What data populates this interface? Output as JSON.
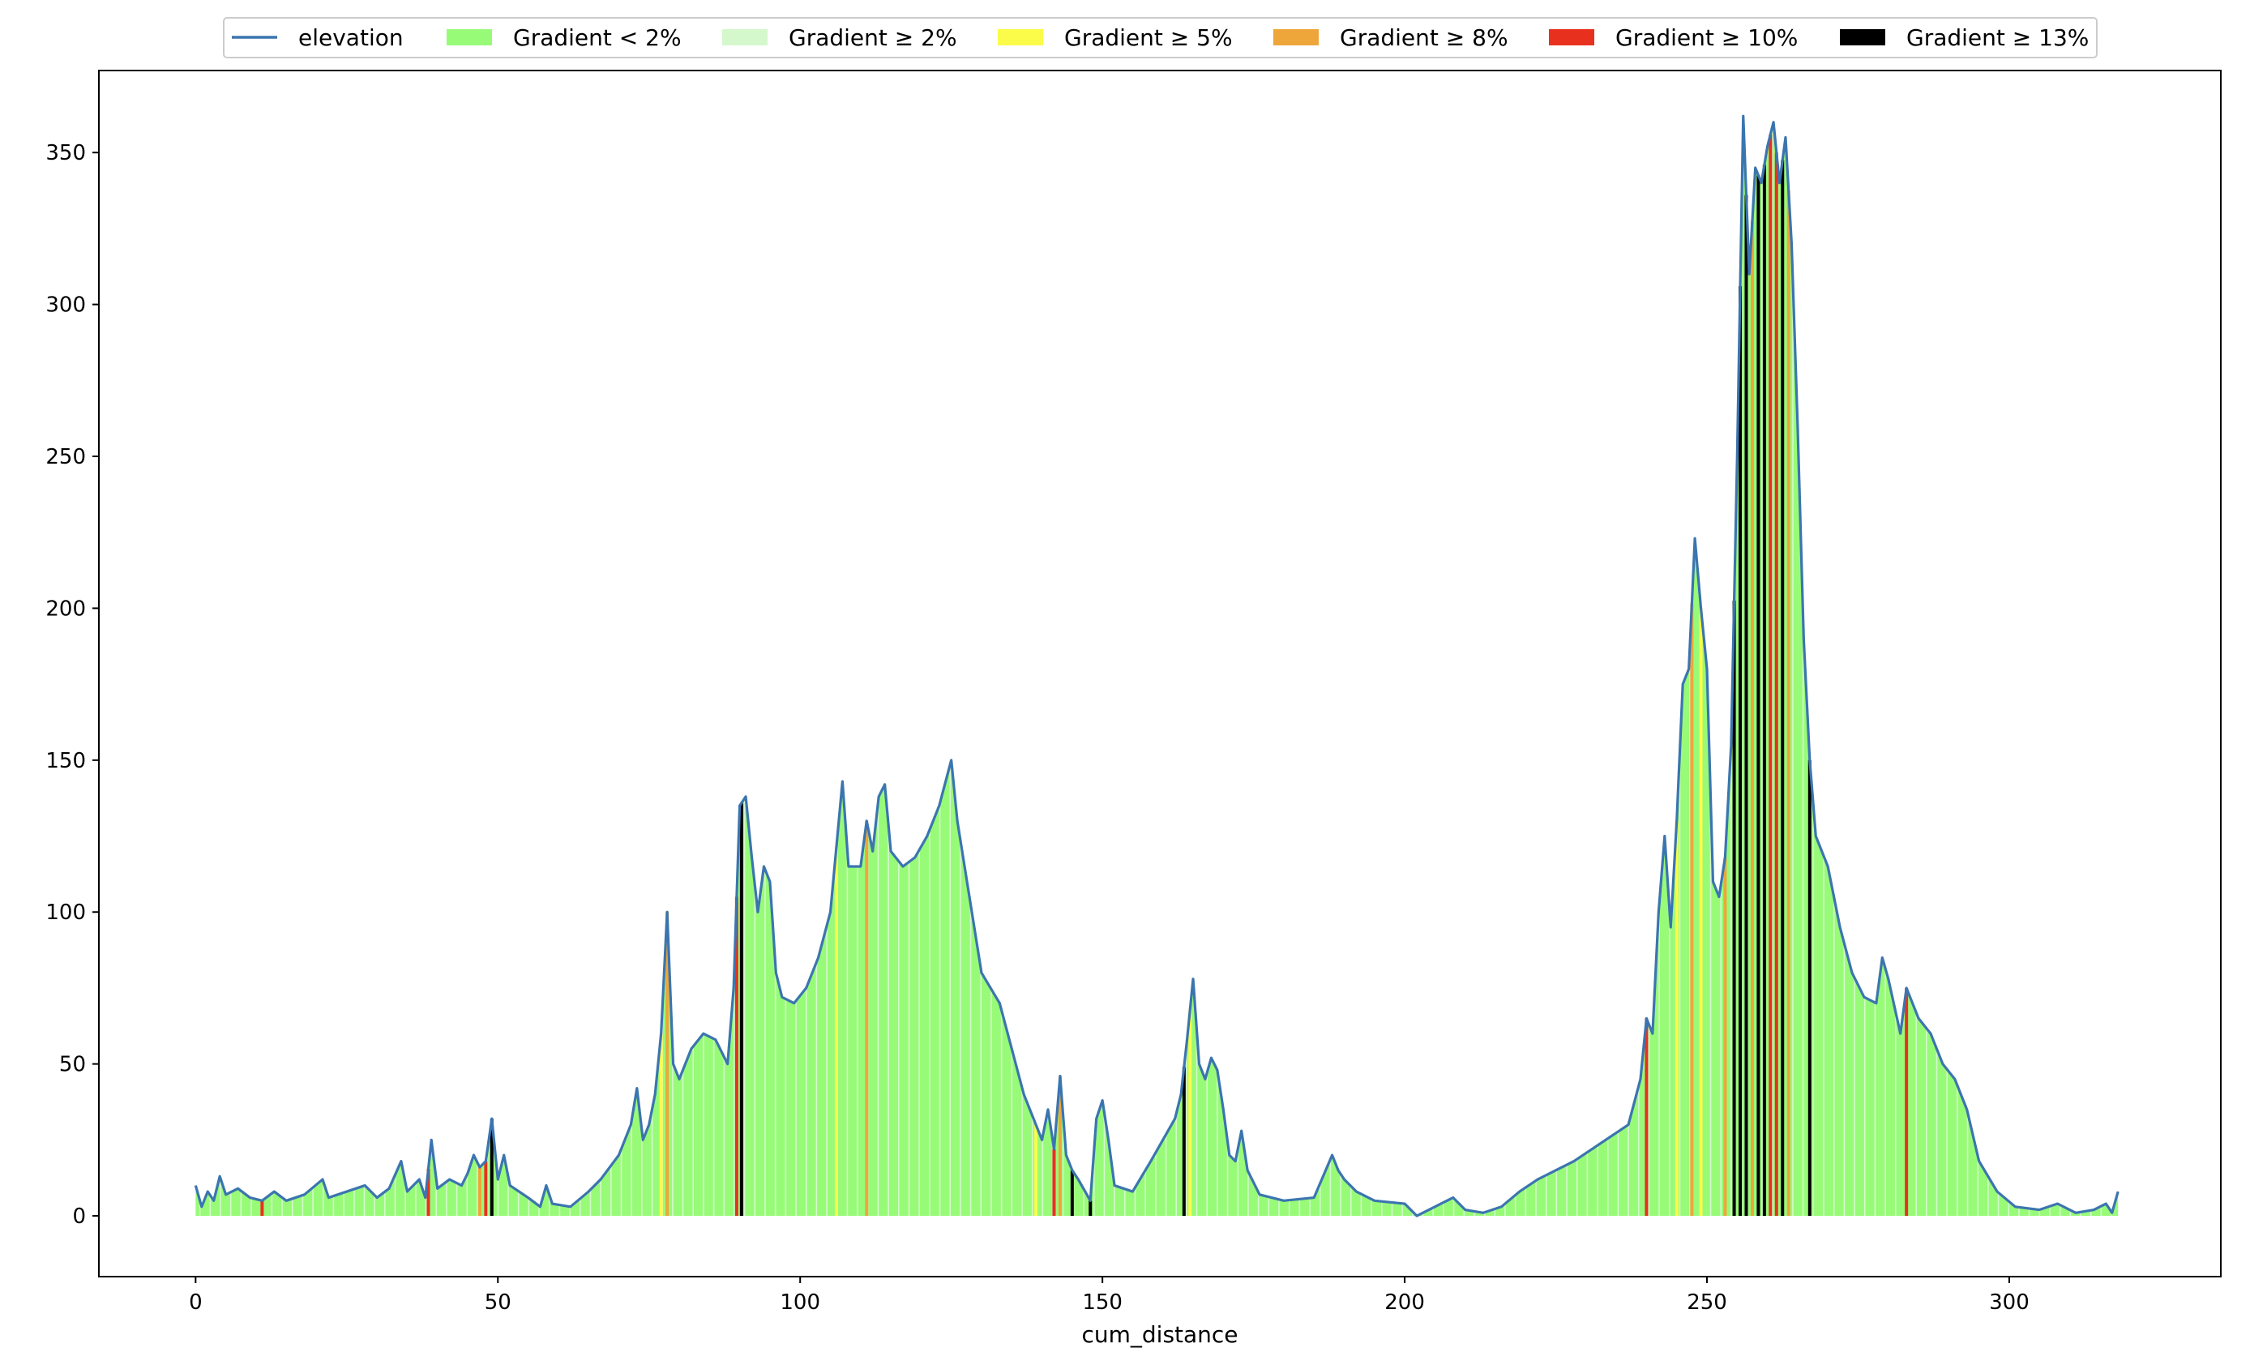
{
  "chart_data": {
    "type": "area",
    "xlabel": "cum_distance",
    "ylabel": "",
    "xlim": [
      -16,
      335
    ],
    "ylim": [
      -20,
      377
    ],
    "xticks": [
      0,
      50,
      100,
      150,
      200,
      250,
      300
    ],
    "yticks": [
      0,
      50,
      100,
      150,
      200,
      250,
      300,
      350
    ],
    "grid": false,
    "legend": {
      "placement": "top-center",
      "entries": [
        {
          "label": "elevation",
          "kind": "line",
          "color": "#3b75af"
        },
        {
          "label": "Gradient < 2%",
          "kind": "patch",
          "color": "#98fb78"
        },
        {
          "label": "Gradient ≥ 2%",
          "kind": "patch",
          "color": "#d4f8cc"
        },
        {
          "label": "Gradient ≥ 5%",
          "kind": "patch",
          "color": "#fbfb4a"
        },
        {
          "label": "Gradient ≥ 8%",
          "kind": "patch",
          "color": "#eea63a"
        },
        {
          "label": "Gradient ≥ 10%",
          "kind": "patch",
          "color": "#e8301f"
        },
        {
          "label": "Gradient ≥ 13%",
          "kind": "patch",
          "color": "#000000"
        }
      ]
    },
    "series": [
      {
        "name": "elevation",
        "points": [
          [
            0,
            10
          ],
          [
            1,
            3
          ],
          [
            2,
            8
          ],
          [
            3,
            5
          ],
          [
            4,
            13
          ],
          [
            5,
            7
          ],
          [
            7,
            9
          ],
          [
            9,
            6
          ],
          [
            11,
            5
          ],
          [
            13,
            8
          ],
          [
            15,
            5
          ],
          [
            18,
            7
          ],
          [
            21,
            12
          ],
          [
            22,
            6
          ],
          [
            25,
            8
          ],
          [
            28,
            10
          ],
          [
            30,
            6
          ],
          [
            32,
            9
          ],
          [
            34,
            18
          ],
          [
            35,
            8
          ],
          [
            37,
            12
          ],
          [
            38,
            6
          ],
          [
            39,
            25
          ],
          [
            40,
            9
          ],
          [
            42,
            12
          ],
          [
            44,
            10
          ],
          [
            45,
            14
          ],
          [
            46,
            20
          ],
          [
            47,
            16
          ],
          [
            48,
            18
          ],
          [
            49,
            32
          ],
          [
            50,
            12
          ],
          [
            51,
            20
          ],
          [
            52,
            10
          ],
          [
            55,
            6
          ],
          [
            57,
            3
          ],
          [
            58,
            10
          ],
          [
            59,
            4
          ],
          [
            62,
            3
          ],
          [
            65,
            8
          ],
          [
            67,
            12
          ],
          [
            70,
            20
          ],
          [
            72,
            30
          ],
          [
            73,
            42
          ],
          [
            74,
            25
          ],
          [
            75,
            30
          ],
          [
            76,
            40
          ],
          [
            77,
            60
          ],
          [
            78,
            100
          ],
          [
            79,
            50
          ],
          [
            80,
            45
          ],
          [
            82,
            55
          ],
          [
            84,
            60
          ],
          [
            86,
            58
          ],
          [
            88,
            50
          ],
          [
            89,
            75
          ],
          [
            90,
            135
          ],
          [
            91,
            138
          ],
          [
            92,
            118
          ],
          [
            93,
            100
          ],
          [
            94,
            115
          ],
          [
            95,
            110
          ],
          [
            96,
            80
          ],
          [
            97,
            72
          ],
          [
            99,
            70
          ],
          [
            101,
            75
          ],
          [
            103,
            85
          ],
          [
            105,
            100
          ],
          [
            107,
            143
          ],
          [
            108,
            115
          ],
          [
            110,
            115
          ],
          [
            111,
            130
          ],
          [
            112,
            120
          ],
          [
            113,
            138
          ],
          [
            114,
            142
          ],
          [
            115,
            120
          ],
          [
            117,
            115
          ],
          [
            119,
            118
          ],
          [
            121,
            125
          ],
          [
            123,
            135
          ],
          [
            125,
            150
          ],
          [
            126,
            130
          ],
          [
            128,
            105
          ],
          [
            130,
            80
          ],
          [
            133,
            70
          ],
          [
            135,
            55
          ],
          [
            137,
            40
          ],
          [
            139,
            30
          ],
          [
            140,
            25
          ],
          [
            141,
            35
          ],
          [
            142,
            22
          ],
          [
            143,
            46
          ],
          [
            144,
            20
          ],
          [
            145,
            15
          ],
          [
            146,
            12
          ],
          [
            148,
            5
          ],
          [
            149,
            32
          ],
          [
            150,
            38
          ],
          [
            151,
            25
          ],
          [
            152,
            10
          ],
          [
            155,
            8
          ],
          [
            158,
            18
          ],
          [
            160,
            25
          ],
          [
            162,
            32
          ],
          [
            163,
            40
          ],
          [
            164,
            58
          ],
          [
            165,
            78
          ],
          [
            166,
            50
          ],
          [
            167,
            45
          ],
          [
            168,
            52
          ],
          [
            169,
            48
          ],
          [
            170,
            35
          ],
          [
            171,
            20
          ],
          [
            172,
            18
          ],
          [
            173,
            28
          ],
          [
            174,
            15
          ],
          [
            176,
            7
          ],
          [
            180,
            5
          ],
          [
            185,
            6
          ],
          [
            188,
            20
          ],
          [
            189,
            15
          ],
          [
            190,
            12
          ],
          [
            192,
            8
          ],
          [
            195,
            5
          ],
          [
            200,
            4
          ],
          [
            202,
            0
          ],
          [
            205,
            3
          ],
          [
            208,
            6
          ],
          [
            210,
            2
          ],
          [
            213,
            1
          ],
          [
            216,
            3
          ],
          [
            219,
            8
          ],
          [
            222,
            12
          ],
          [
            225,
            15
          ],
          [
            228,
            18
          ],
          [
            231,
            22
          ],
          [
            234,
            26
          ],
          [
            237,
            30
          ],
          [
            239,
            45
          ],
          [
            240,
            65
          ],
          [
            241,
            60
          ],
          [
            242,
            100
          ],
          [
            243,
            125
          ],
          [
            244,
            95
          ],
          [
            245,
            130
          ],
          [
            246,
            175
          ],
          [
            247,
            180
          ],
          [
            248,
            223
          ],
          [
            249,
            200
          ],
          [
            250,
            180
          ],
          [
            251,
            110
          ],
          [
            252,
            105
          ],
          [
            253,
            118
          ],
          [
            254,
            155
          ],
          [
            255,
            250
          ],
          [
            256,
            362
          ],
          [
            257,
            310
          ],
          [
            258,
            345
          ],
          [
            259,
            340
          ],
          [
            260,
            352
          ],
          [
            261,
            360
          ],
          [
            262,
            340
          ],
          [
            263,
            355
          ],
          [
            264,
            320
          ],
          [
            265,
            260
          ],
          [
            266,
            190
          ],
          [
            267,
            150
          ],
          [
            268,
            125
          ],
          [
            270,
            115
          ],
          [
            272,
            95
          ],
          [
            274,
            80
          ],
          [
            276,
            72
          ],
          [
            278,
            70
          ],
          [
            279,
            85
          ],
          [
            280,
            78
          ],
          [
            282,
            60
          ],
          [
            283,
            75
          ],
          [
            285,
            65
          ],
          [
            287,
            60
          ],
          [
            289,
            50
          ],
          [
            291,
            45
          ],
          [
            293,
            35
          ],
          [
            295,
            18
          ],
          [
            298,
            8
          ],
          [
            301,
            3
          ],
          [
            305,
            2
          ],
          [
            308,
            4
          ],
          [
            311,
            1
          ],
          [
            314,
            2
          ],
          [
            316,
            4
          ],
          [
            317,
            1
          ],
          [
            318,
            8
          ]
        ]
      }
    ],
    "gradient_segments": [
      {
        "x": 11,
        "class": "Gradient ≥ 10%"
      },
      {
        "x": 38.5,
        "class": "Gradient ≥ 10%"
      },
      {
        "x": 47,
        "class": "Gradient ≥ 8%"
      },
      {
        "x": 48,
        "class": "Gradient ≥ 10%"
      },
      {
        "x": 49,
        "class": "Gradient ≥ 13%"
      },
      {
        "x": 77,
        "class": "Gradient ≥ 5%"
      },
      {
        "x": 78,
        "class": "Gradient ≥ 8%"
      },
      {
        "x": 89.5,
        "class": "Gradient ≥ 10%"
      },
      {
        "x": 90.3,
        "class": "Gradient ≥ 13%"
      },
      {
        "x": 106,
        "class": "Gradient ≥ 5%"
      },
      {
        "x": 111,
        "class": "Gradient ≥ 8%"
      },
      {
        "x": 139,
        "class": "Gradient ≥ 5%"
      },
      {
        "x": 142,
        "class": "Gradient ≥ 10%"
      },
      {
        "x": 143,
        "class": "Gradient ≥ 8%"
      },
      {
        "x": 145,
        "class": "Gradient ≥ 13%"
      },
      {
        "x": 148,
        "class": "Gradient ≥ 13%"
      },
      {
        "x": 163.5,
        "class": "Gradient ≥ 13%"
      },
      {
        "x": 164.5,
        "class": "Gradient ≥ 5%"
      },
      {
        "x": 240,
        "class": "Gradient ≥ 10%"
      },
      {
        "x": 245,
        "class": "Gradient ≥ 5%"
      },
      {
        "x": 247.5,
        "class": "Gradient ≥ 8%"
      },
      {
        "x": 249,
        "class": "Gradient ≥ 5%"
      },
      {
        "x": 253,
        "class": "Gradient ≥ 8%"
      },
      {
        "x": 254.5,
        "class": "Gradient ≥ 13%"
      },
      {
        "x": 255.5,
        "class": "Gradient ≥ 13%"
      },
      {
        "x": 256.5,
        "class": "Gradient ≥ 13%"
      },
      {
        "x": 257.5,
        "class": "Gradient ≥ 8%"
      },
      {
        "x": 258.5,
        "class": "Gradient ≥ 13%"
      },
      {
        "x": 259.5,
        "class": "Gradient ≥ 13%"
      },
      {
        "x": 260.5,
        "class": "Gradient ≥ 10%"
      },
      {
        "x": 261.5,
        "class": "Gradient ≥ 10%"
      },
      {
        "x": 262.5,
        "class": "Gradient ≥ 13%"
      },
      {
        "x": 263.5,
        "class": "Gradient ≥ 8%"
      },
      {
        "x": 267,
        "class": "Gradient ≥ 13%"
      },
      {
        "x": 283,
        "class": "Gradient ≥ 10%"
      }
    ]
  }
}
